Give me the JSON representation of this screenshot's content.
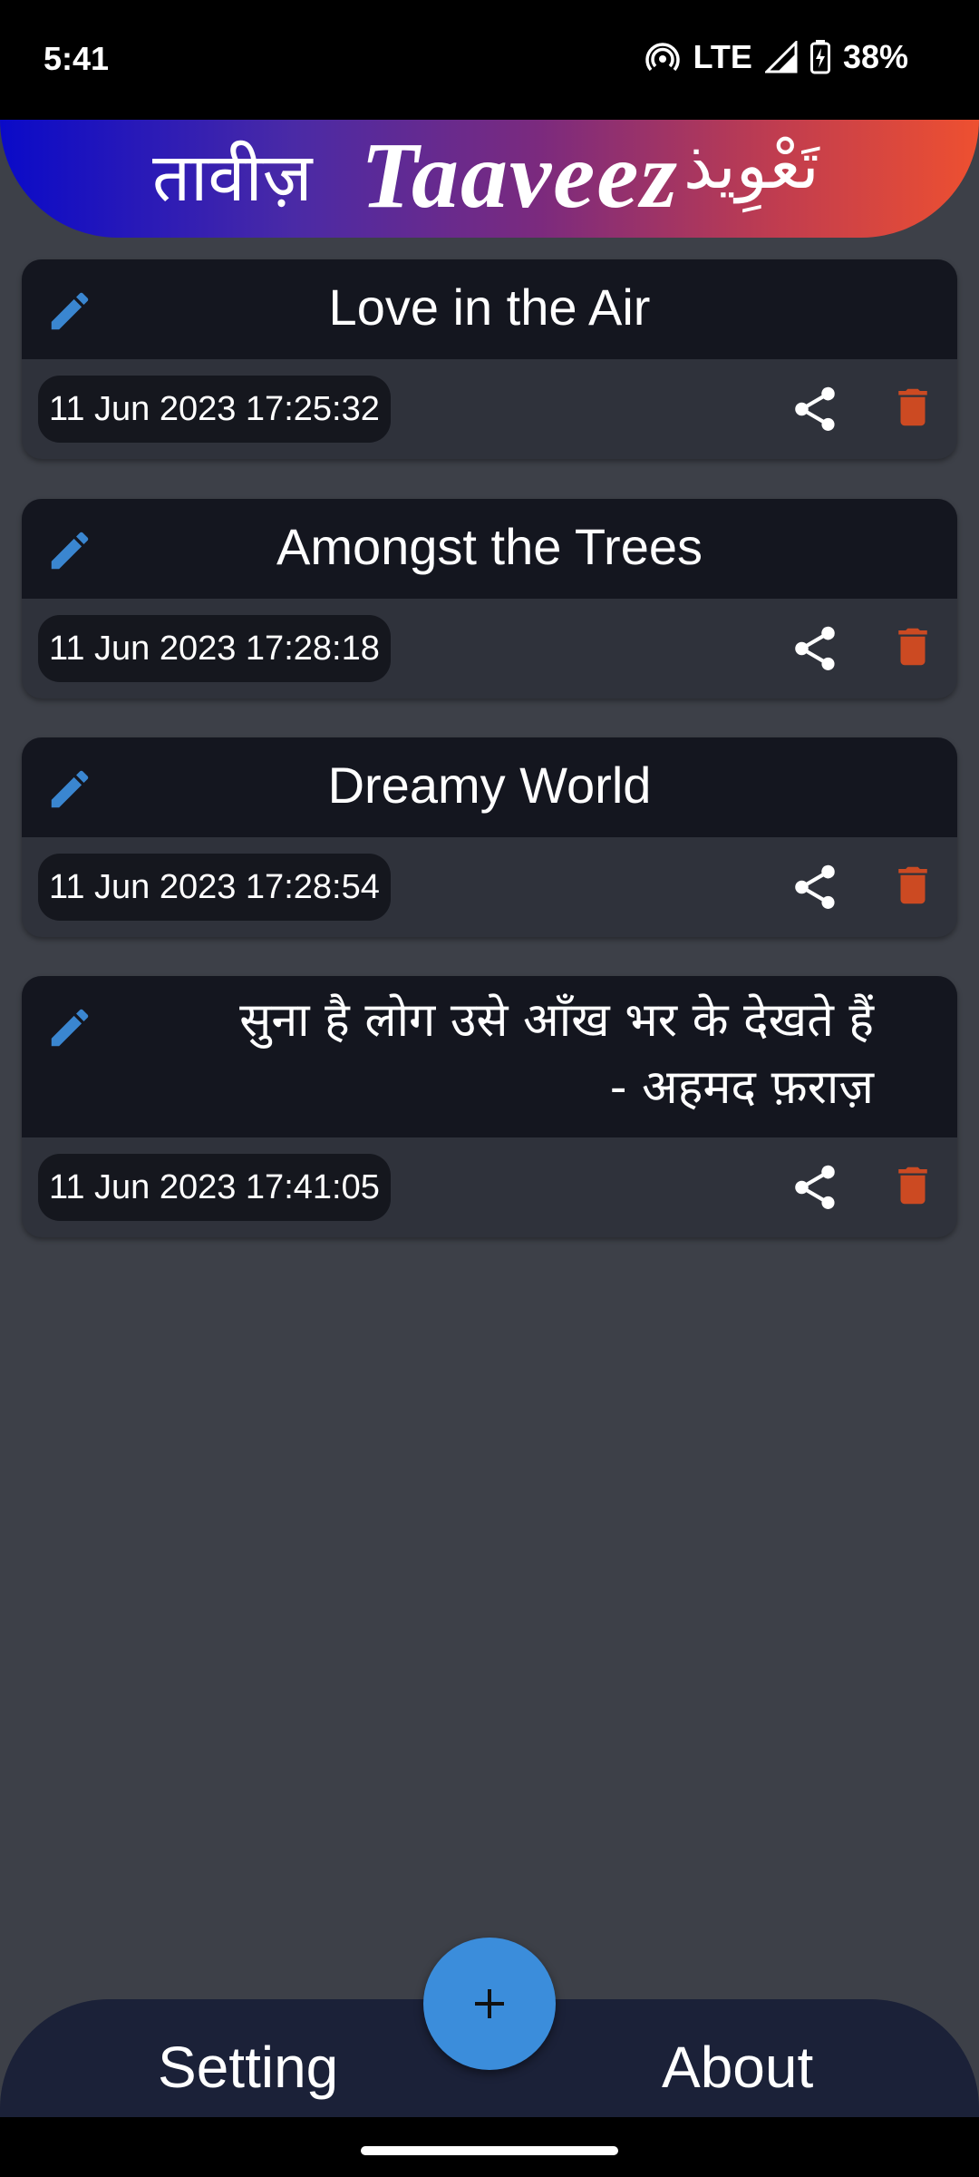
{
  "status_bar": {
    "time": "5:41",
    "network": "LTE",
    "battery": "38%"
  },
  "header": {
    "hindi": "तावीज़",
    "latin": "Taaveez",
    "urdu": "تَعْوِیذ"
  },
  "notes": [
    {
      "title": "Love in the Air",
      "date": "11 Jun 2023 17:25:32"
    },
    {
      "title": "Amongst the Trees",
      "date": "11 Jun 2023 17:28:18"
    },
    {
      "title": "Dreamy World",
      "date": "11 Jun 2023 17:28:54"
    },
    {
      "title_line1": "सुना है लोग उसे आँख भर के देखते हैं",
      "title_line2": "- अहमद फ़राज़",
      "date": "11 Jun 2023 17:41:05"
    }
  ],
  "bottom_nav": {
    "setting_label": "Setting",
    "about_label": "About"
  },
  "fab": {
    "icon": "plus-icon"
  },
  "colors": {
    "background": "#3d4048",
    "card_header": "#14161f",
    "card_body": "#2f323b",
    "edit_icon": "#3a86d0",
    "delete_icon": "#cc4a22",
    "fab": "#3b8ddb",
    "nav": "#1b2138"
  }
}
